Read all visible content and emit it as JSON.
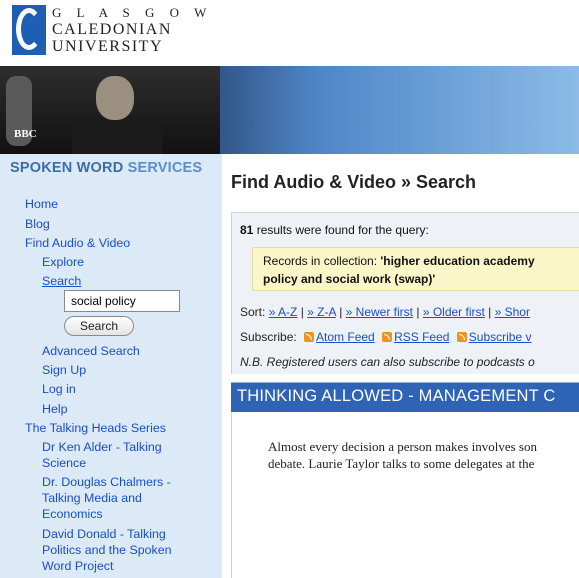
{
  "brand": {
    "line1": "G L A S G O W",
    "line2": "CALEDONIAN",
    "line3": "UNIVERSITY"
  },
  "banner": {
    "bbc_logo": "BBC"
  },
  "sidebar": {
    "title_part1": "SPOKEN WORD",
    "title_part2": " SERVICES",
    "search_value": "social policy",
    "search_button": "Search",
    "nav": [
      "Home",
      "Blog",
      "Find Audio & Video",
      "Explore",
      "Search",
      "Advanced Search",
      "Sign Up",
      "Log in",
      "Help",
      "The Talking Heads Series",
      "Dr Ken Alder - Talking",
      "Science",
      "Dr. Douglas Chalmers -",
      "Talking Media and",
      "Economics",
      "David Donald - Talking",
      "Politics and the Spoken",
      "Word Project"
    ]
  },
  "main": {
    "title": "Find Audio & Video » Search",
    "result_count": "81",
    "result_suffix": " results were found for the query:",
    "query_prefix": "Records in collection: ",
    "query_value_line1": "'higher education academy",
    "query_value_line2": "policy and social work (swap)'",
    "sort_label": "Sort: ",
    "sort_options": [
      "» A-Z",
      "» Z-A",
      "» Newer first",
      "» Older first",
      "» Shor"
    ],
    "subscribe_label": "Subscribe: ",
    "subscribe_options": [
      "Atom Feed",
      "RSS Feed",
      "Subscribe v"
    ],
    "note": "N.B. Registered users can also subscribe to podcasts o",
    "item_title": "THINKING ALLOWED - MANAGEMENT C",
    "item_desc_line1": "Almost every decision a person makes involves son",
    "item_desc_line2": "debate. Laurie Taylor talks to some delegates at the"
  },
  "colors": {
    "sidebar_bg": "#dce9f6",
    "link": "#1a4fc7",
    "item_header": "#2f63b5",
    "query_highlight": "#fbf6c8"
  }
}
